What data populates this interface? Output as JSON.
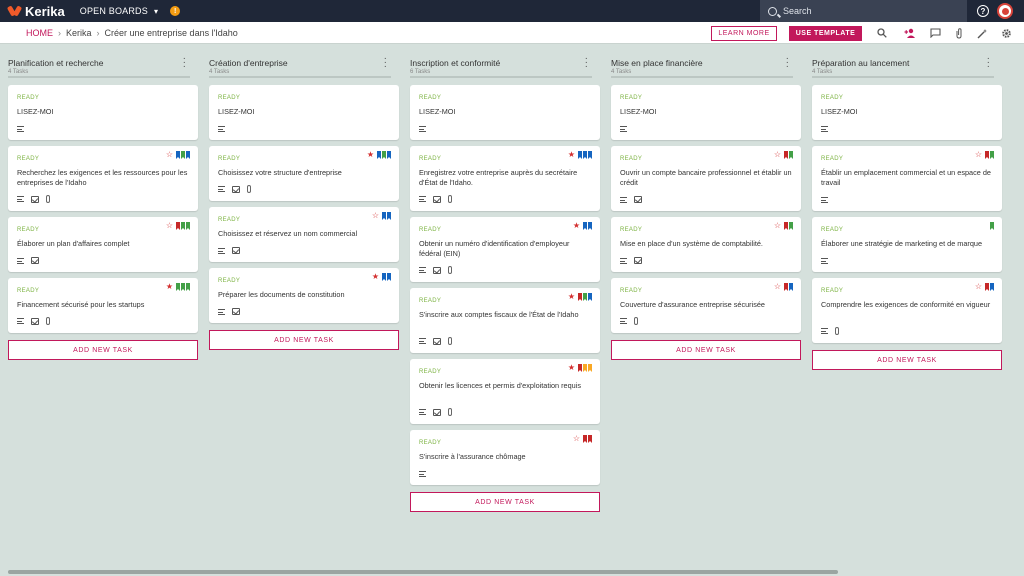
{
  "topbar": {
    "app_name": "Kerika",
    "boards_label": "OPEN BOARDS",
    "search_placeholder": "Search"
  },
  "breadcrumb": {
    "home": "HOME",
    "team": "Kerika",
    "board": "Créer une entreprise dans l'Idaho"
  },
  "actions": {
    "learn_more": "LEARN MORE",
    "use_template": "USE TEMPLATE"
  },
  "icons": [
    "search-icon",
    "add-user-icon",
    "chat-icon",
    "attachment-icon",
    "settings-wand-icon",
    "gear-icon"
  ],
  "colors": {
    "accent": "#c2185b",
    "ready": "#7cb342",
    "topbar": "#1f2738",
    "background": "#d5e0dc"
  },
  "columns": [
    {
      "title": "Planification et recherche",
      "count": "4 Tasks",
      "add_label": "ADD NEW TASK",
      "cards": [
        {
          "status": "READY",
          "title": "LISEZ-MOI",
          "icons": [
            "desc"
          ],
          "star": "",
          "flags": []
        },
        {
          "status": "READY",
          "title": "Recherchez les exigences et les ressources pour les entreprises de l'Idaho",
          "icons": [
            "desc",
            "check",
            "clip"
          ],
          "star": "outline",
          "flags": [
            "#1565c0",
            "#43a047",
            "#1565c0"
          ]
        },
        {
          "status": "READY",
          "title": "Élaborer un plan d'affaires complet",
          "icons": [
            "desc",
            "check"
          ],
          "star": "outline",
          "flags": [
            "#c62828",
            "#43a047",
            "#43a047"
          ]
        },
        {
          "status": "READY",
          "title": "Financement sécurisé pour les startups",
          "icons": [
            "desc",
            "check",
            "clip"
          ],
          "star": "filled",
          "flags": [
            "#43a047",
            "#43a047",
            "#43a047"
          ]
        }
      ]
    },
    {
      "title": "Création d'entreprise",
      "count": "4 Tasks",
      "add_label": "ADD NEW TASK",
      "cards": [
        {
          "status": "READY",
          "title": "LISEZ-MOI",
          "icons": [
            "desc"
          ],
          "star": "",
          "flags": []
        },
        {
          "status": "READY",
          "title": "Choisissez votre structure d'entreprise",
          "icons": [
            "desc",
            "check",
            "clip"
          ],
          "star": "filled",
          "flags": [
            "#1565c0",
            "#43a047",
            "#1565c0"
          ]
        },
        {
          "status": "READY",
          "title": "Choisissez et réservez un nom commercial",
          "icons": [
            "desc",
            "check"
          ],
          "star": "outline",
          "flags": [
            "#1565c0",
            "#1565c0"
          ]
        },
        {
          "status": "READY",
          "title": "Préparer les documents de constitution",
          "icons": [
            "desc",
            "check"
          ],
          "star": "filled",
          "flags": [
            "#1565c0",
            "#1565c0"
          ]
        }
      ]
    },
    {
      "title": "Inscription et conformité",
      "count": "6 Tasks",
      "add_label": "ADD NEW TASK",
      "cards": [
        {
          "status": "READY",
          "title": "LISEZ-MOI",
          "icons": [
            "desc"
          ],
          "star": "",
          "flags": []
        },
        {
          "status": "READY",
          "title": "Enregistrez votre entreprise auprès du secrétaire d'État de l'Idaho.",
          "icons": [
            "desc",
            "check",
            "clip"
          ],
          "star": "filled",
          "flags": [
            "#1565c0",
            "#1565c0",
            "#1565c0"
          ]
        },
        {
          "status": "READY",
          "title": "Obtenir un numéro d'identification d'employeur fédéral (EIN)",
          "icons": [
            "desc",
            "check",
            "clip"
          ],
          "star": "filled",
          "flags": [
            "#1565c0",
            "#1565c0"
          ]
        },
        {
          "status": "READY",
          "title": "S'inscrire aux comptes fiscaux de l'État de l'Idaho",
          "icons": [
            "desc",
            "check",
            "clip"
          ],
          "star": "filled",
          "flags": [
            "#c62828",
            "#43a047",
            "#1565c0"
          ]
        },
        {
          "status": "READY",
          "title": "Obtenir les licences et permis d'exploitation requis",
          "icons": [
            "desc",
            "check",
            "clip"
          ],
          "star": "filled",
          "flags": [
            "#c62828",
            "#f9a825",
            "#f9a825"
          ]
        },
        {
          "status": "READY",
          "title": "S'inscrire à l'assurance chômage",
          "icons": [
            "desc"
          ],
          "star": "outline",
          "flags": [
            "#c62828",
            "#c62828"
          ]
        }
      ]
    },
    {
      "title": "Mise en place financière",
      "count": "4 Tasks",
      "add_label": "ADD NEW TASK",
      "cards": [
        {
          "status": "READY",
          "title": "LISEZ-MOI",
          "icons": [
            "desc"
          ],
          "star": "",
          "flags": []
        },
        {
          "status": "READY",
          "title": "Ouvrir un compte bancaire professionnel et établir un crédit",
          "icons": [
            "desc",
            "check"
          ],
          "star": "outline",
          "flags": [
            "#c62828",
            "#43a047"
          ]
        },
        {
          "status": "READY",
          "title": "Mise en place d'un système de comptabilité.",
          "icons": [
            "desc",
            "check"
          ],
          "star": "outline",
          "flags": [
            "#c62828",
            "#43a047"
          ]
        },
        {
          "status": "READY",
          "title": "Couverture d'assurance entreprise sécurisée",
          "icons": [
            "desc",
            "clip"
          ],
          "star": "outline",
          "flags": [
            "#c62828",
            "#1565c0"
          ]
        }
      ]
    },
    {
      "title": "Préparation au lancement",
      "count": "4 Tasks",
      "add_label": "ADD NEW TASK",
      "cards": [
        {
          "status": "READY",
          "title": "LISEZ-MOI",
          "icons": [
            "desc"
          ],
          "star": "",
          "flags": []
        },
        {
          "status": "READY",
          "title": "Établir un emplacement commercial et un espace de travail",
          "icons": [
            "desc"
          ],
          "star": "outline",
          "flags": [
            "#c62828",
            "#43a047"
          ]
        },
        {
          "status": "READY",
          "title": "Élaborer une stratégie de marketing et de marque",
          "icons": [
            "desc"
          ],
          "star": "",
          "flags": [
            "#43a047"
          ]
        },
        {
          "status": "READY",
          "title": "Comprendre les exigences de conformité en vigueur",
          "icons": [
            "desc",
            "clip"
          ],
          "star": "outline",
          "flags": [
            "#c62828",
            "#1565c0"
          ]
        }
      ]
    }
  ]
}
